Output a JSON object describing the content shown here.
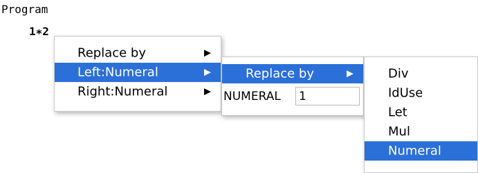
{
  "program": {
    "title": "Program",
    "expression": "1∗2"
  },
  "menu1": {
    "items": [
      {
        "label": "Replace by",
        "arrow": "▶",
        "selected": false
      },
      {
        "label": "Left:Numeral",
        "arrow": "▶",
        "selected": true
      },
      {
        "label": "Right:Numeral",
        "arrow": "▶",
        "selected": false
      }
    ]
  },
  "menu2": {
    "replace_item": {
      "label": "Replace by",
      "arrow": "▶",
      "selected": true
    },
    "numeral_label": "NUMERAL",
    "numeral_value": "1"
  },
  "menu3": {
    "items": [
      {
        "label": "Div",
        "selected": false
      },
      {
        "label": "IdUse",
        "selected": false
      },
      {
        "label": "Let",
        "selected": false
      },
      {
        "label": "Mul",
        "selected": false
      },
      {
        "label": "Numeral",
        "selected": true
      }
    ]
  },
  "colors": {
    "selection": "#2b6fd9",
    "menu_background": "#ffffff",
    "menu_border": "#c8c8c8"
  },
  "icons": {
    "submenu_arrow": "submenu-arrow-icon"
  }
}
